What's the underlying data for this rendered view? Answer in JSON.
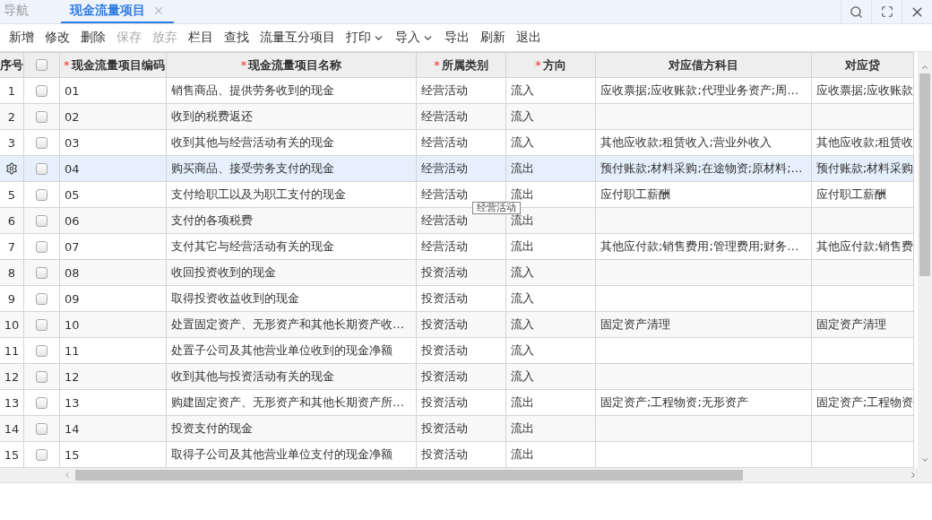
{
  "tabs": [
    {
      "label": "导航",
      "selected": false,
      "closable": false
    },
    {
      "label": "现金流量项目",
      "selected": true,
      "closable": true
    }
  ],
  "toolbar": [
    {
      "label": "新增",
      "disabled": false,
      "dropdown": false
    },
    {
      "label": "修改",
      "disabled": false,
      "dropdown": false
    },
    {
      "label": "删除",
      "disabled": false,
      "dropdown": false
    },
    {
      "label": "保存",
      "disabled": true,
      "dropdown": false
    },
    {
      "label": "放弃",
      "disabled": true,
      "dropdown": false
    },
    {
      "label": "栏目",
      "disabled": false,
      "dropdown": false
    },
    {
      "label": "查找",
      "disabled": false,
      "dropdown": false
    },
    {
      "label": "流量互分项目",
      "disabled": false,
      "dropdown": false
    },
    {
      "label": "打印",
      "disabled": false,
      "dropdown": true
    },
    {
      "label": "导入",
      "disabled": false,
      "dropdown": true
    },
    {
      "label": "导出",
      "disabled": false,
      "dropdown": false
    },
    {
      "label": "刷新",
      "disabled": false,
      "dropdown": false
    },
    {
      "label": "退出",
      "disabled": false,
      "dropdown": false
    }
  ],
  "table": {
    "index_header": "序号",
    "select_all": {
      "checked": false
    },
    "columns": [
      {
        "label": "现金流量项目编码",
        "mark": "*"
      },
      {
        "label": "现金流量项目名称",
        "mark": "*"
      },
      {
        "label": "所属类别",
        "mark": "*"
      },
      {
        "label": "方向",
        "mark": "*"
      },
      {
        "label": "对应借方科目"
      },
      {
        "label": "对应贷"
      }
    ],
    "rows": [
      {
        "index": "1",
        "checked": false,
        "selected": false,
        "cells": [
          "01",
          "销售商品、提供劳务收到的现金",
          "经营活动",
          "流入",
          "应收票据;应收账款;代理业务资产;周…",
          "应收票据;应收账款"
        ]
      },
      {
        "index": "2",
        "checked": false,
        "selected": false,
        "cells": [
          "02",
          "收到的税费返还",
          "经营活动",
          "流入",
          "",
          ""
        ]
      },
      {
        "index": "3",
        "checked": false,
        "selected": false,
        "cells": [
          "03",
          "收到其他与经营活动有关的现金",
          "经营活动",
          "流入",
          "其他应收款;租赁收入;营业外收入",
          "其他应收款;租赁收"
        ]
      },
      {
        "checked": false,
        "selected": true,
        "cells": [
          "04",
          "购买商品、接受劳务支付的现金",
          "经营活动",
          "流出",
          "预付账款;材料采购;在途物资;原材料;…",
          "预付账款;材料采购"
        ]
      },
      {
        "index": "5",
        "checked": false,
        "selected": false,
        "cells": [
          "05",
          "支付给职工以及为职工支付的现金",
          "经营活动",
          "流出",
          "应付职工薪酬",
          "应付职工薪酬"
        ]
      },
      {
        "index": "6",
        "checked": false,
        "selected": false,
        "cells": [
          "06",
          "支付的各项税费",
          "经营活动",
          "流出",
          "",
          ""
        ]
      },
      {
        "index": "7",
        "checked": false,
        "selected": false,
        "cells": [
          "07",
          "支付其它与经营活动有关的现金",
          "经营活动",
          "流出",
          "其他应付款;销售费用;管理费用;财务…",
          "其他应付款;销售费"
        ]
      },
      {
        "index": "8",
        "checked": false,
        "selected": false,
        "cells": [
          "08",
          "收回投资收到的现金",
          "投资活动",
          "流入",
          "",
          ""
        ]
      },
      {
        "index": "9",
        "checked": false,
        "selected": false,
        "cells": [
          "09",
          "取得投资收益收到的现金",
          "投资活动",
          "流入",
          "",
          ""
        ]
      },
      {
        "index": "10",
        "checked": false,
        "selected": false,
        "cells": [
          "10",
          "处置固定资产、无形资产和其他长期资产收…",
          "投资活动",
          "流入",
          "固定资产清理",
          "固定资产清理"
        ]
      },
      {
        "index": "11",
        "checked": false,
        "selected": false,
        "cells": [
          "11",
          "处置子公司及其他营业单位收到的现金净额",
          "投资活动",
          "流入",
          "",
          ""
        ]
      },
      {
        "index": "12",
        "checked": false,
        "selected": false,
        "cells": [
          "12",
          "收到其他与投资活动有关的现金",
          "投资活动",
          "流入",
          "",
          ""
        ]
      },
      {
        "index": "13",
        "checked": false,
        "selected": false,
        "cells": [
          "13",
          "购建固定资产、无形资产和其他长期资产所…",
          "投资活动",
          "流出",
          "固定资产;工程物资;无形资产",
          "固定资产;工程物资"
        ]
      },
      {
        "index": "14",
        "checked": false,
        "selected": false,
        "cells": [
          "14",
          "投资支付的现金",
          "投资活动",
          "流出",
          "",
          ""
        ]
      },
      {
        "index": "15",
        "checked": false,
        "selected": false,
        "cells": [
          "15",
          "取得子公司及其他营业单位支付的现金净额",
          "投资活动",
          "流出",
          "",
          ""
        ]
      }
    ]
  },
  "tooltip": {
    "text": "经营活动"
  }
}
